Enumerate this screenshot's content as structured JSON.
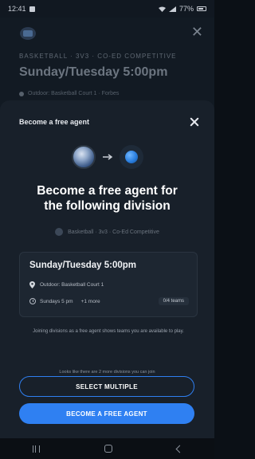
{
  "status_bar": {
    "time": "12:41",
    "right_text": "77%"
  },
  "background_page": {
    "kicker": "BASKETBALL · 3V3 · CO-ED COMPETITIVE",
    "title": "Sunday/Tuesday 5:00pm",
    "location": "Outdoor: Basketball Court 1 · Forbes"
  },
  "sheet": {
    "title": "Become a free agent",
    "headline_line1": "Become a free agent for",
    "headline_line2": "the following division",
    "division_label": "Basketball · 3v3 · Co-Ed Competitive",
    "card": {
      "title": "Sunday/Tuesday 5:00pm",
      "location": "Outdoor: Basketball Court 1",
      "time": "Sundays 5 pm",
      "more": "+1 more",
      "teams": "0/4 teams"
    },
    "info_text": "Joining divisions as a free agent shows teams you are available to play.",
    "hint_text": "Looks like there are 2 more divisions you can join",
    "select_multiple_label": "SELECT MULTIPLE",
    "become_free_agent_label": "BECOME A FREE AGENT"
  },
  "colors": {
    "accent": "#2f80f2",
    "sheet_bg": "#18202a",
    "card_bg": "#1d2631"
  },
  "icons": {
    "close": "close-icon",
    "arrow": "arrow-right-icon",
    "basketball": "basketball-icon",
    "pin": "location-pin-icon",
    "clock": "clock-icon"
  }
}
